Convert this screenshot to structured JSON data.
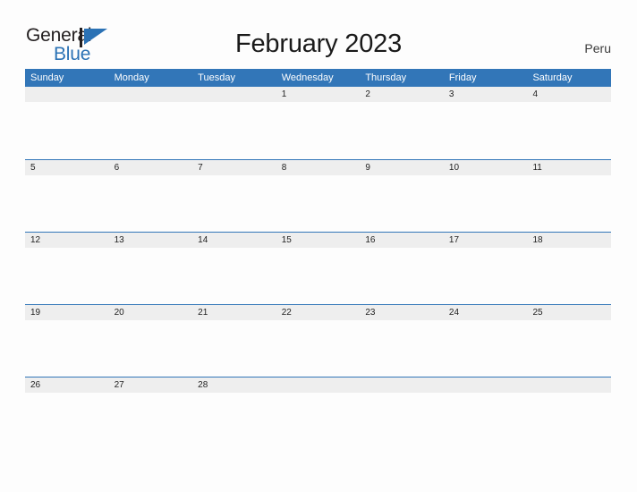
{
  "brand": {
    "name_part1": "General",
    "name_part2": "Blue",
    "flag_icon": "flag-triangle-icon",
    "colors": {
      "text": "#231f20",
      "blue": "#2b72b5"
    }
  },
  "header": {
    "title": "February 2023",
    "country": "Peru"
  },
  "calendar": {
    "accent_color": "#3276b8",
    "band_color": "#eeeeee",
    "weekdays": [
      "Sunday",
      "Monday",
      "Tuesday",
      "Wednesday",
      "Thursday",
      "Friday",
      "Saturday"
    ],
    "weeks": [
      [
        "",
        "",
        "",
        "1",
        "2",
        "3",
        "4"
      ],
      [
        "5",
        "6",
        "7",
        "8",
        "9",
        "10",
        "11"
      ],
      [
        "12",
        "13",
        "14",
        "15",
        "16",
        "17",
        "18"
      ],
      [
        "19",
        "20",
        "21",
        "22",
        "23",
        "24",
        "25"
      ],
      [
        "26",
        "27",
        "28",
        "",
        "",
        "",
        ""
      ]
    ]
  }
}
